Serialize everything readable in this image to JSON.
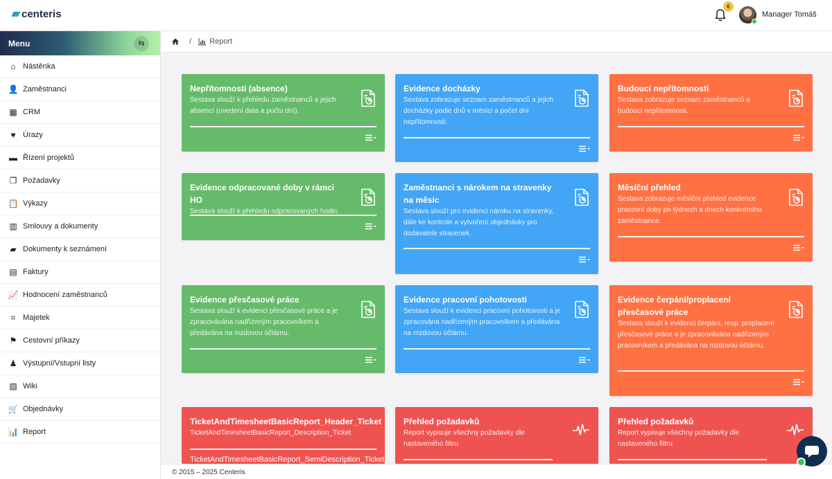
{
  "app": {
    "logo_text": "centeris"
  },
  "header": {
    "notifications_count": "6",
    "user_name": "Manager Tomáš"
  },
  "sidebar": {
    "title": "Menu",
    "items": [
      {
        "label": "Nástěnka",
        "icon": "home-icon"
      },
      {
        "label": "Zaměstnanci",
        "icon": "user-icon"
      },
      {
        "label": "CRM",
        "icon": "grid-icon"
      },
      {
        "label": "Úrazy",
        "icon": "heart-icon"
      },
      {
        "label": "Řízení projektů",
        "icon": "chat-icon"
      },
      {
        "label": "Požadavky",
        "icon": "copy-icon"
      },
      {
        "label": "Výkazy",
        "icon": "clipboard-icon"
      },
      {
        "label": "Smlouvy a dokumenty",
        "icon": "books-icon"
      },
      {
        "label": "Dokumenty k seznámení",
        "icon": "book-icon"
      },
      {
        "label": "Faktury",
        "icon": "invoice-icon"
      },
      {
        "label": "Hodnocení zaměstnanců",
        "icon": "chart-line-icon"
      },
      {
        "label": "Majetek",
        "icon": "chair-icon"
      },
      {
        "label": "Cestovní příkazy",
        "icon": "signpost-icon"
      },
      {
        "label": "Výstupní/Vstupní listy",
        "icon": "person-tie-icon"
      },
      {
        "label": "Wiki",
        "icon": "wiki-book-icon"
      },
      {
        "label": "Objednávky",
        "icon": "cart-icon"
      },
      {
        "label": "Report",
        "icon": "bar-chart-icon"
      }
    ]
  },
  "breadcrumb": {
    "current": "Report"
  },
  "cards": [
    {
      "title": "Nepřítomnosti (absence)",
      "desc": "Sestava slouží k přehledu zaměstnanců a jejich absencí (uvedení data a počtu dní).",
      "color": "#66bb6a"
    },
    {
      "title": "Evidence docházky",
      "desc": "Sestava zobrazuje seznam zaměstnanců a jejich docházky podle dnů v měsíci a počet dní nepřítomnosti.",
      "color": "#42a5f5"
    },
    {
      "title": "Budoucí nepřítomnosti",
      "desc": "Sestava zobrazuje seznam zaměstnanců a budoucí nepřítomnosti.",
      "color": "#ff7043"
    },
    {
      "title": "Evidence odpracované doby v rámci HO",
      "desc": "Sestava slouží k přehledu odpracovaných hodin.",
      "color": "#66bb6a"
    },
    {
      "title": "Zaměstnanci s nárokem na stravenky na měsíc",
      "desc": "Sestava slouží pro evidenci nároku na stravenky, dále ke kontrole a vytvoření objednávky pro dodavatele stravenek.",
      "color": "#42a5f5"
    },
    {
      "title": "Měsíční přehled",
      "desc": "Sestava zobrazuje měsíční přehled evidence pracovní doby po týdnech a dnech konkrétního zaměstnance.",
      "color": "#ff7043"
    },
    {
      "title": "Evidence přesčasové práce",
      "desc": "Sestava slouží k evidenci přesčasové práce a je zpracovávána nadřízeným pracovníkem a předávána na mzdovou účtárnu.",
      "color": "#66bb6a"
    },
    {
      "title": "Evidence pracovní pohotovosti",
      "desc": "Sestava slouží k evidenci pracovní pohotovosti a je zpracována nadřízeným pracovníkem a předávána na mzdovou účtárnu.",
      "color": "#42a5f5"
    },
    {
      "title": "Evidence čerpání/proplacení přesčasové práce",
      "desc": "Sestava slouží k evidenci čerpání, resp. proplacení přesčasové práce a je zpracovávána nadřízeným pracovníkem a předávána na mzdovou účtárnu.",
      "color": "#ff7043"
    },
    {
      "title": "TicketAndTimesheetBasicReport_Header_Ticket",
      "desc": "TicketAndTimesheetBasicReport_Description_Ticket",
      "extra": "TicketAndTimesheetBasicReport_SemiDescription_Ticket",
      "color": "#ef5350"
    },
    {
      "title": "Přehled požadavků",
      "desc": "Report vypisuje všechny požadavky dle nastaveného filtru",
      "color": "#ef5350"
    },
    {
      "title": "Přehled požadavků",
      "desc": "Report vypisuje všechny požadavky dle nastaveného filtru",
      "color": "#ef5350"
    }
  ],
  "footer": {
    "text": "© 2015 – 2025 Centeris"
  }
}
